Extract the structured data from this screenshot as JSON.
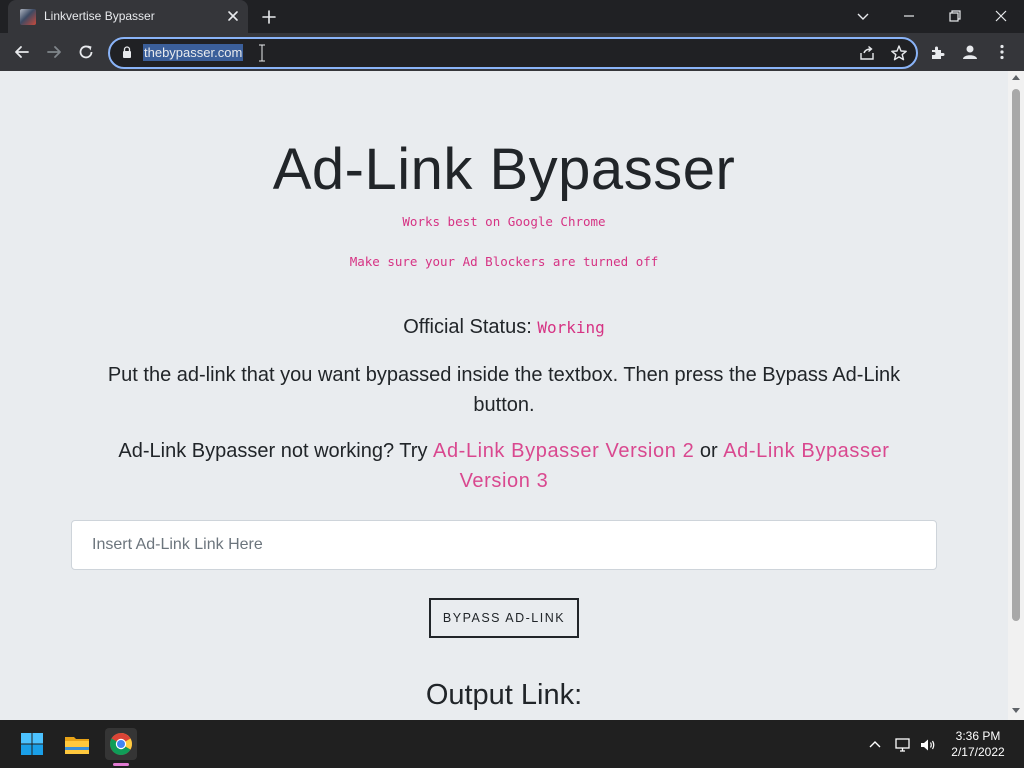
{
  "browser": {
    "tab_title": "Linkvertise Bypasser",
    "url": "thebypasser.com"
  },
  "page": {
    "title": "Ad-Link Bypasser",
    "note_chrome": "Works best on Google Chrome",
    "note_adblock": "Make sure your Ad Blockers are turned off",
    "status_label": "Official Status:",
    "status_value": "Working",
    "instructions": "Put the ad-link that you want bypassed inside the textbox. Then press the Bypass Ad-Link button.",
    "alt_prefix": "Ad-Link Bypasser not working? Try",
    "alt_link_v2": "Ad-Link Bypasser Version 2",
    "alt_or": "or",
    "alt_link_v3": "Ad-Link Bypasser Version 3",
    "input_placeholder": "Insert Ad-Link Link Here",
    "bypass_button": "BYPASS AD-LINK",
    "output_heading": "Output Link:"
  },
  "taskbar": {
    "time": "3:36 PM",
    "date": "2/17/2022"
  },
  "colors": {
    "accent_pink": "#d63384",
    "link_pink": "#d9488f",
    "page_bg": "#e9ecef",
    "browser_dark": "#202124",
    "omnibox_focus": "#8ab4f8"
  },
  "icons": [
    "tab-favicon",
    "close-icon",
    "plus-icon",
    "chevron-down-icon",
    "minimize-icon",
    "restore-icon",
    "window-close-icon",
    "back-arrow-icon",
    "forward-arrow-icon",
    "reload-icon",
    "lock-icon",
    "share-icon",
    "star-icon",
    "extensions-icon",
    "profile-icon",
    "kebab-menu-icon",
    "windows-start-icon",
    "file-explorer-icon",
    "chrome-icon",
    "chevron-up-icon",
    "network-icon",
    "volume-icon"
  ]
}
